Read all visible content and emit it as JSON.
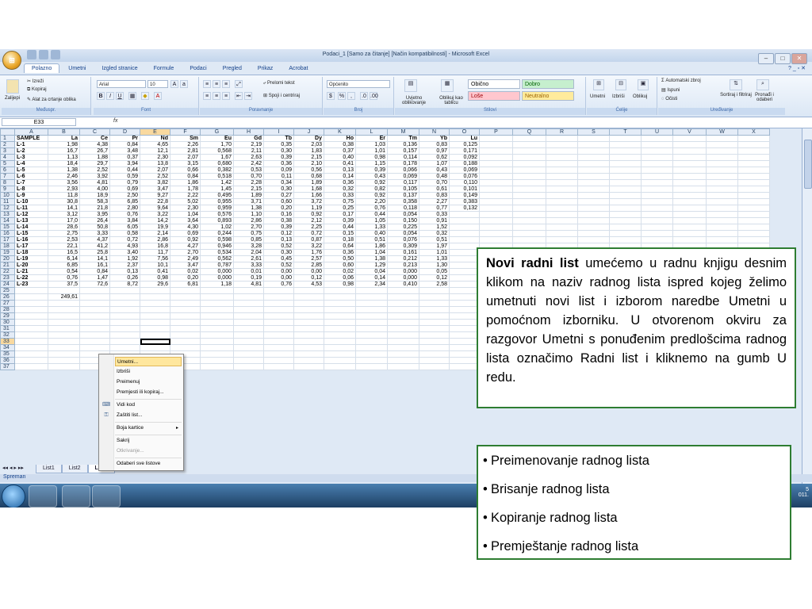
{
  "window": {
    "title": "Podaci_1  [Samo za čitanje]  [Način kompatibilnosti] - Microsoft Excel",
    "office_button": "Office"
  },
  "ribbon_tabs": [
    "Polazno",
    "Umetni",
    "Izgled stranice",
    "Formule",
    "Podaci",
    "Pregled",
    "Prikaz",
    "Acrobat"
  ],
  "active_tab": "Polazno",
  "ribbon": {
    "clipboard": {
      "paste": "Zalijepi",
      "cut": "Izreži",
      "copy": "Kopiraj",
      "format_painter": "Alat za crtanje oblika",
      "label": "Međuspr."
    },
    "font": {
      "name": "Arial",
      "size": "10",
      "bold": "B",
      "italic": "I",
      "underline": "U",
      "label": "Font"
    },
    "alignment": {
      "wrap": "Prelomi tekst",
      "merge": "Spoji i centriraj",
      "label": "Poravnanje"
    },
    "number": {
      "format": "Općenito",
      "label": "Broj"
    },
    "styles": {
      "conditional": "Uvjetno oblikovanje",
      "table": "Oblikuj kao tablicu",
      "normal": "Obično",
      "good": "Dobro",
      "bad": "Loše",
      "neutral": "Neutralno",
      "label": "Stilovi"
    },
    "cells": {
      "insert": "Umetni",
      "delete": "Izbriši",
      "format": "Oblikuj",
      "label": "Ćelije"
    },
    "editing": {
      "autosum": "Automatski zbroj",
      "fill": "Ispuni",
      "clear": "Očisti",
      "sort": "Sortiraj i filtriraj",
      "find": "Pronađi i odaberi",
      "label": "Uređivanje"
    }
  },
  "formula_bar": {
    "name_box": "E33",
    "fx": "fx",
    "value": ""
  },
  "sheet": {
    "columns": [
      "A",
      "B",
      "C",
      "D",
      "E",
      "F",
      "G",
      "H",
      "I",
      "J",
      "K",
      "L",
      "M",
      "N",
      "O",
      "P",
      "Q",
      "R",
      "S",
      "T",
      "U",
      "V",
      "W",
      "X"
    ],
    "header_row": [
      "SAMPLE",
      "La",
      "Ce",
      "Pr",
      "Nd",
      "Sm",
      "Eu",
      "Gd",
      "Tb",
      "Dy",
      "Ho",
      "Er",
      "Tm",
      "Yb",
      "Lu"
    ],
    "rows": [
      [
        "L-1",
        "1,98",
        "4,38",
        "0,84",
        "4,65",
        "2,26",
        "1,70",
        "2,19",
        "0,35",
        "2,03",
        "0,38",
        "1,03",
        "0,136",
        "0,83",
        "0,125"
      ],
      [
        "L-2",
        "16,7",
        "26,7",
        "3,48",
        "12,1",
        "2,81",
        "0,568",
        "2,11",
        "0,30",
        "1,83",
        "0,37",
        "1,01",
        "0,157",
        "0,97",
        "0,171"
      ],
      [
        "L-3",
        "1,13",
        "1,88",
        "0,37",
        "2,30",
        "2,07",
        "1,67",
        "2,63",
        "0,39",
        "2,15",
        "0,40",
        "0,98",
        "0,114",
        "0,62",
        "0,092"
      ],
      [
        "L-4",
        "18,4",
        "29,7",
        "3,94",
        "13,8",
        "3,15",
        "0,680",
        "2,42",
        "0,36",
        "2,10",
        "0,41",
        "1,15",
        "0,178",
        "1,07",
        "0,188"
      ],
      [
        "L-5",
        "1,38",
        "2,52",
        "0,44",
        "2,07",
        "0,66",
        "0,382",
        "0,53",
        "0,09",
        "0,56",
        "0,13",
        "0,39",
        "0,066",
        "0,43",
        "0,069"
      ],
      [
        "L-6",
        "2,46",
        "3,92",
        "0,59",
        "2,52",
        "0,84",
        "0,518",
        "0,70",
        "0,11",
        "0,68",
        "0,14",
        "0,43",
        "0,069",
        "0,48",
        "0,076"
      ],
      [
        "L-7",
        "3,56",
        "4,81",
        "0,79",
        "3,82",
        "1,86",
        "1,42",
        "2,28",
        "0,34",
        "1,89",
        "0,36",
        "0,92",
        "0,117",
        "0,70",
        "0,110"
      ],
      [
        "L-8",
        "2,93",
        "4,00",
        "0,69",
        "3,47",
        "1,78",
        "1,45",
        "2,15",
        "0,30",
        "1,68",
        "0,32",
        "0,82",
        "0,105",
        "0,61",
        "0,101"
      ],
      [
        "L-9",
        "11,8",
        "18,9",
        "2,50",
        "9,27",
        "2,22",
        "0,495",
        "1,89",
        "0,27",
        "1,66",
        "0,33",
        "0,92",
        "0,137",
        "0,83",
        "0,149"
      ],
      [
        "L-10",
        "30,8",
        "58,3",
        "6,85",
        "22,8",
        "5,02",
        "0,955",
        "3,71",
        "0,60",
        "3,72",
        "0,75",
        "2,20",
        "0,358",
        "2,27",
        "0,383"
      ],
      [
        "L-11",
        "14,1",
        "21,8",
        "2,80",
        "9,64",
        "2,30",
        "0,959",
        "1,38",
        "0,20",
        "1,19",
        "0,25",
        "0,76",
        "0,118",
        "0,77",
        "0,132"
      ],
      [
        "L-12",
        "3,12",
        "3,95",
        "0,76",
        "3,22",
        "1,04",
        "0,576",
        "1,10",
        "0,16",
        "0,92",
        "0,17",
        "0,44",
        "0,054",
        "0,33",
        ""
      ],
      [
        "L-13",
        "17,0",
        "26,4",
        "3,84",
        "14,2",
        "3,64",
        "0,893",
        "2,86",
        "0,38",
        "2,12",
        "0,39",
        "1,05",
        "0,150",
        "0,91",
        ""
      ],
      [
        "L-14",
        "28,6",
        "50,8",
        "6,05",
        "19,9",
        "4,30",
        "1,02",
        "2,70",
        "0,39",
        "2,25",
        "0,44",
        "1,33",
        "0,225",
        "1,52",
        ""
      ],
      [
        "L-15",
        "2,75",
        "3,33",
        "0,58",
        "2,14",
        "0,69",
        "0,244",
        "0,75",
        "0,12",
        "0,72",
        "0,15",
        "0,40",
        "0,054",
        "0,32",
        ""
      ],
      [
        "L-16",
        "2,53",
        "4,37",
        "0,72",
        "2,86",
        "0,92",
        "0,598",
        "0,85",
        "0,13",
        "0,87",
        "0,18",
        "0,51",
        "0,076",
        "0,51",
        ""
      ],
      [
        "L-17",
        "22,1",
        "41,2",
        "4,93",
        "16,8",
        "4,27",
        "0,946",
        "3,28",
        "0,52",
        "3,22",
        "0,64",
        "1,86",
        "0,309",
        "1,97",
        ""
      ],
      [
        "L-18",
        "16,5",
        "25,8",
        "3,40",
        "11,7",
        "2,70",
        "0,534",
        "2,04",
        "0,30",
        "1,76",
        "0,36",
        "1,04",
        "0,161",
        "1,01",
        ""
      ],
      [
        "L-19",
        "6,14",
        "14,1",
        "1,92",
        "7,56",
        "2,49",
        "0,562",
        "2,61",
        "0,45",
        "2,57",
        "0,50",
        "1,38",
        "0,212",
        "1,33",
        ""
      ],
      [
        "L-20",
        "6,85",
        "16,1",
        "2,37",
        "10,1",
        "3,47",
        "0,787",
        "3,33",
        "0,52",
        "2,85",
        "0,60",
        "1,29",
        "0,213",
        "1,30",
        ""
      ],
      [
        "L-21",
        "0,54",
        "0,84",
        "0,13",
        "0,41",
        "0,02",
        "0,000",
        "0,01",
        "0,00",
        "0,00",
        "0,02",
        "0,04",
        "0,000",
        "0,05",
        ""
      ],
      [
        "L-22",
        "0,76",
        "1,47",
        "0,26",
        "0,98",
        "0,20",
        "0,000",
        "0,19",
        "0,00",
        "0,12",
        "0,06",
        "0,14",
        "0,000",
        "0,12",
        ""
      ],
      [
        "L-23",
        "37,5",
        "72,6",
        "8,72",
        "29,6",
        "6,81",
        "1,18",
        "4,81",
        "0,76",
        "4,53",
        "0,98",
        "2,34",
        "0,410",
        "2,58",
        ""
      ]
    ],
    "row26_b": "249,61",
    "row_numbers_extra": [
      "25",
      "26",
      "27",
      "28",
      "29",
      "30",
      "31",
      "32",
      "33",
      "34",
      "35",
      "36",
      "37"
    ],
    "active_cell": "E33",
    "tabs": [
      "List1",
      "List2",
      "List3"
    ],
    "active_sheet_tab": "List3",
    "status": "Spreman"
  },
  "context_menu": [
    {
      "label": "Umetni...",
      "icon": "",
      "highlighted": true,
      "disabled": false
    },
    {
      "label": "Izbriši",
      "icon": "",
      "highlighted": false,
      "disabled": false
    },
    {
      "label": "Preimenuj",
      "icon": "",
      "highlighted": false,
      "disabled": false
    },
    {
      "label": "Premjesti ili kopiraj...",
      "icon": "",
      "highlighted": false,
      "disabled": false
    },
    {
      "label": "Vidi kod",
      "icon": "code-icon",
      "highlighted": false,
      "disabled": false
    },
    {
      "label": "Zaštiti list...",
      "icon": "protect-icon",
      "highlighted": false,
      "disabled": false
    },
    {
      "label": "Boja kartice",
      "icon": "",
      "highlighted": false,
      "disabled": false,
      "submenu": true
    },
    {
      "label": "Sakrij",
      "icon": "",
      "highlighted": false,
      "disabled": false
    },
    {
      "label": "Otkrivanje...",
      "icon": "",
      "highlighted": false,
      "disabled": true
    },
    {
      "label": "Odaberi sve listove",
      "icon": "",
      "highlighted": false,
      "disabled": false
    }
  ],
  "taskbar": {
    "clock_line1": "5",
    "clock_line2": "011."
  },
  "callout1": {
    "bold": "Novi radni list",
    "text": " umećemo u radnu knjigu desnim klikom na naziv radnog lista ispred kojeg želimo umetnuti novi list i izborom naredbe Umetni u pomoćnom izborniku. U otvorenom okviru za razgovor Umetni s ponuđenim predlošcima radnog lista označimo Radni list i kliknemo na gumb U redu."
  },
  "callout2": {
    "items": [
      "Preimenovanje radnog lista",
      "Brisanje radnog lista",
      "Kopiranje radnog lista",
      "Premještanje radnog lista"
    ]
  },
  "colors": {
    "accent": "#2e7d32",
    "ribbon": "#dbe7f5",
    "selected_header": "#f9d99f",
    "menu_highlight": "#ffe79e"
  }
}
